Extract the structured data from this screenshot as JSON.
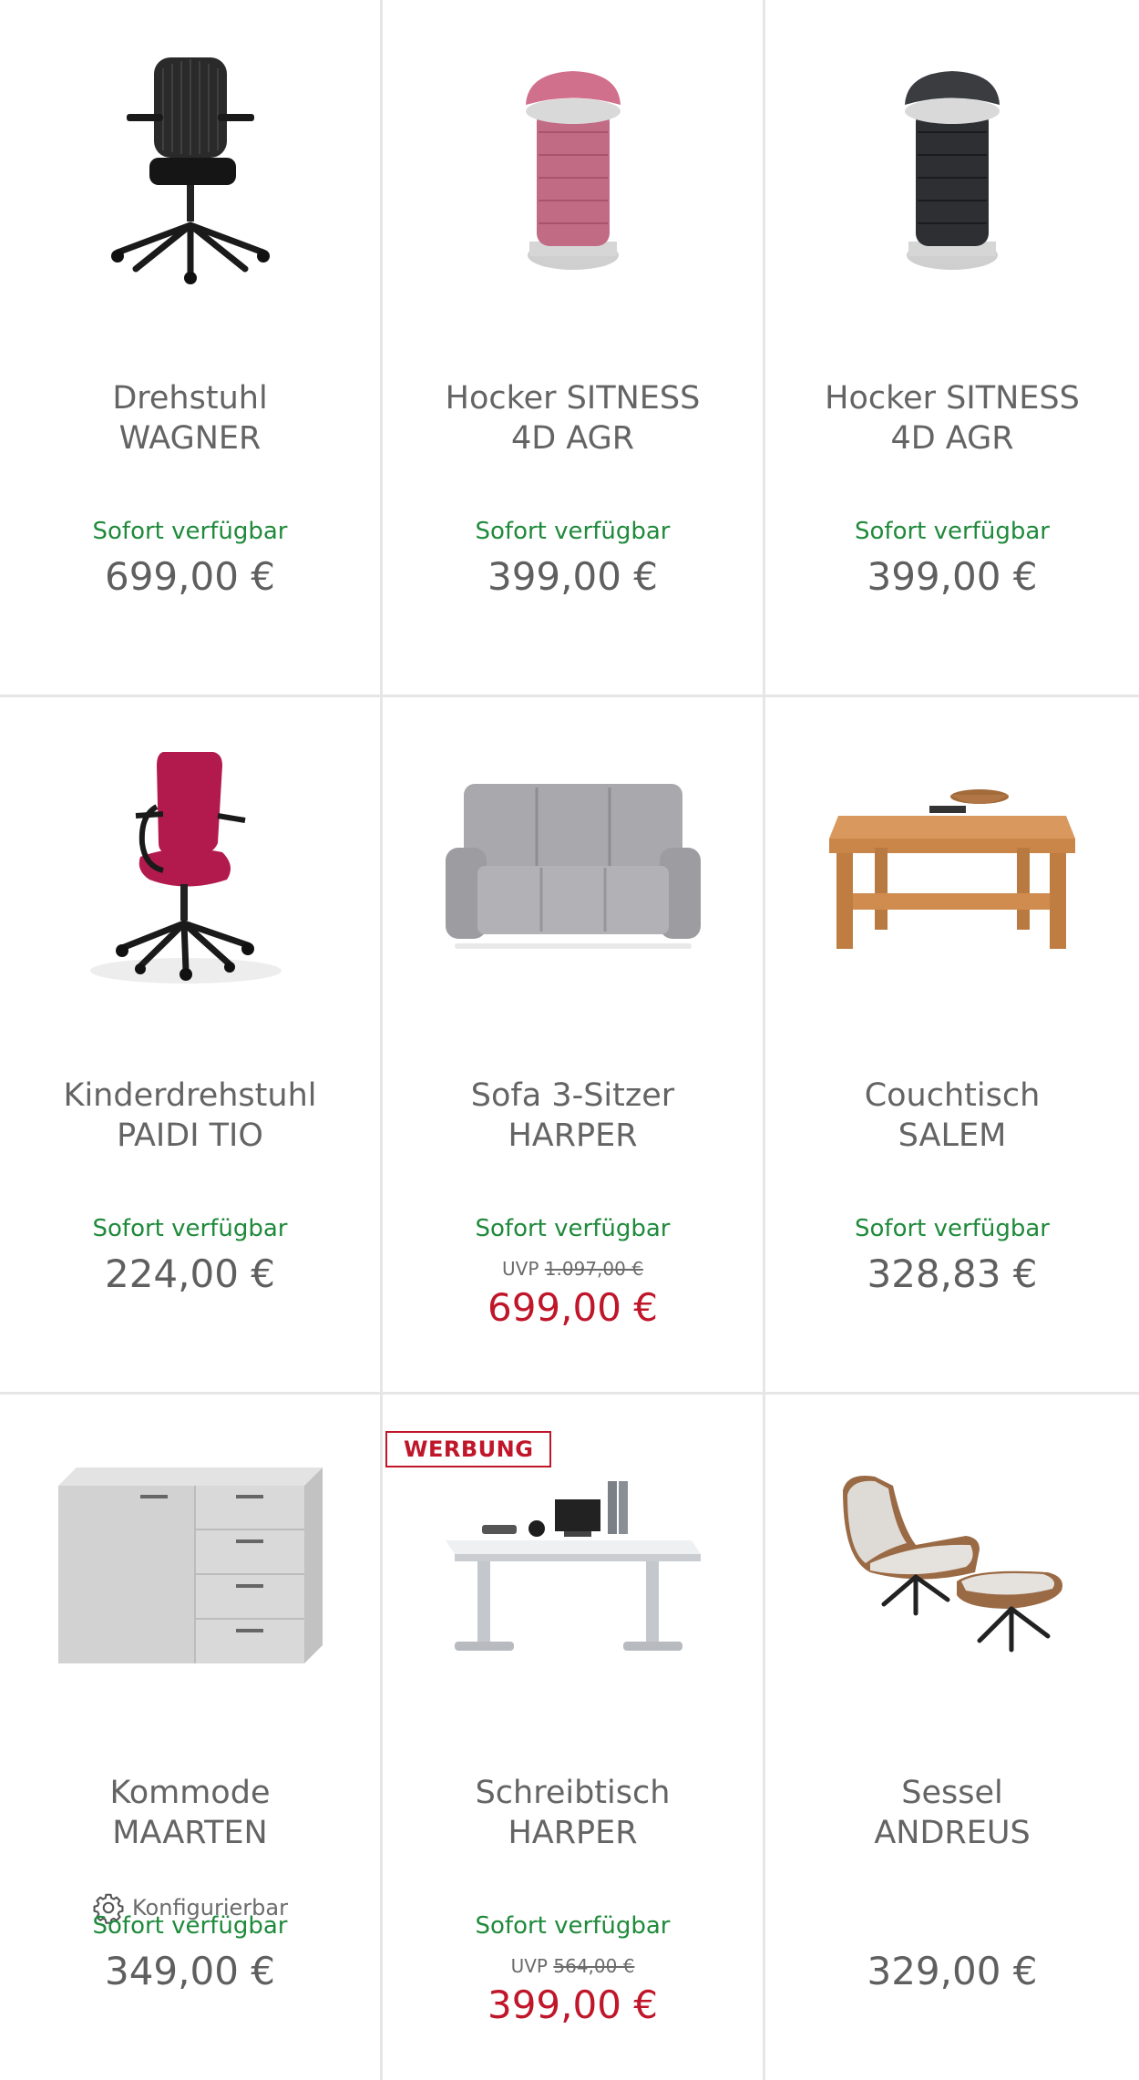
{
  "availability_label": "Sofort verfügbar",
  "colors": {
    "available": "#1f8a3b",
    "sale": "#c0162a",
    "text": "#5f5f5f"
  },
  "products": [
    {
      "name_line1": "Drehstuhl",
      "name_line2": "WAGNER",
      "availability": "Sofort verfügbar",
      "price": "699,00 €",
      "icon": "office-chair-black"
    },
    {
      "name_line1": "Hocker SITNESS",
      "name_line2": "4D AGR",
      "availability": "Sofort verfügbar",
      "price": "399,00 €",
      "icon": "stool-pink"
    },
    {
      "name_line1": "Hocker SITNESS",
      "name_line2": "4D AGR",
      "availability": "Sofort verfügbar",
      "price": "399,00 €",
      "icon": "stool-black"
    },
    {
      "name_line1": "Kinderdrehstuhl",
      "name_line2": "PAIDI TIO",
      "availability": "Sofort verfügbar",
      "price": "224,00 €",
      "icon": "office-chair-pink"
    },
    {
      "name_line1": "Sofa 3-Sitzer",
      "name_line2": "HARPER",
      "availability": "Sofort verfügbar",
      "uvp_label": "UVP",
      "uvp_price": "1.097,00 €",
      "price": "699,00 €",
      "icon": "sofa-grey"
    },
    {
      "name_line1": "Couchtisch",
      "name_line2": "SALEM",
      "availability": "Sofort verfügbar",
      "price": "328,83 €",
      "icon": "coffee-table-wood"
    },
    {
      "name_line1": "Kommode",
      "name_line2": "MAARTEN",
      "configurable": "Konfigurierbar",
      "availability": "Sofort verfügbar",
      "price": "349,00 €",
      "icon": "sideboard-grey"
    },
    {
      "badge": "WERBUNG",
      "name_line1": "Schreibtisch",
      "name_line2": "HARPER",
      "availability": "Sofort verfügbar",
      "uvp_label": "UVP",
      "uvp_price": "564,00 €",
      "price": "399,00 €",
      "icon": "standing-desk"
    },
    {
      "name_line1": "Sessel",
      "name_line2": "ANDREUS",
      "price": "329,00 €",
      "icon": "lounge-chair"
    }
  ]
}
